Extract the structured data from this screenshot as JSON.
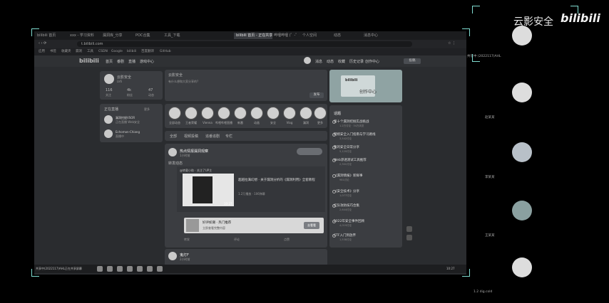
{
  "overlay": {
    "watermark": "云影安全",
    "brand": "bilibili",
    "top_right_caption": "共享中 (2022117)AHL"
  },
  "browser": {
    "tabs": [
      "bilibili 首页",
      "xxx - 学习资料",
      "漏洞库_分享",
      "POC合集",
      "工具_下载",
      "bilibili 首页 - 正在共享",
      "哔哩哔哩 (゜-゜)",
      "个人空间",
      "动态",
      "消息中心"
    ],
    "url": "t.bilibili.com",
    "bookmarks": [
      "应用",
      "书签",
      "收藏夹",
      "漏洞",
      "工具",
      "CSDN",
      "Google",
      "bilibili",
      "百度翻译",
      "GitHub"
    ]
  },
  "site": {
    "logo": "bilibili",
    "nav_left": [
      "首页",
      "番剧",
      "直播",
      "游戏中心",
      "会员购",
      "漫画",
      "赛事"
    ],
    "nav_right": [
      "消息",
      "动态",
      "收藏",
      "历史记录",
      "创作中心",
      "投稿"
    ]
  },
  "profile": {
    "name": "云影安全",
    "level": "LV6",
    "stats": [
      {
        "value": "116",
        "label": "关注"
      },
      {
        "value": "4k",
        "label": "粉丝"
      },
      {
        "value": "47",
        "label": "动态"
      }
    ]
  },
  "live": {
    "title": "正在直播",
    "more": "更多",
    "items": [
      {
        "name": "漏洞挖掘VSOR",
        "desc": "正在直播 Web安全"
      },
      {
        "name": "Echomon-Chiang",
        "desc": "直播中"
      }
    ]
  },
  "compose": {
    "title": "云影安全",
    "placeholder": "有什么想和大家分享的?",
    "publish": "发布"
  },
  "follow_circles": [
    {
      "name": "全部动态"
    },
    {
      "name": "王者荣耀"
    },
    {
      "name": "Vienna"
    },
    {
      "name": "哔哩哔哩直播"
    },
    {
      "name": "新番"
    },
    {
      "name": "动画"
    },
    {
      "name": "安全"
    },
    {
      "name": "Vlog"
    },
    {
      "name": "漏洞"
    },
    {
      "name": "更多"
    }
  ],
  "feed_tabs": [
    "全部",
    "视频投稿",
    "追番追剧",
    "专栏"
  ],
  "post1": {
    "author": "热点情报漏洞观察",
    "time": "1小时前",
    "text": "转发动态",
    "inner_author": "@转载小助 · 关注了UP主",
    "video_title": "超越拉满幻想 · 关于漏洞分析的《漏洞利用》全套教程",
    "video_meta": "1.2万播放 · 106弹幕",
    "duration": "10:27",
    "link_title": "好评如潮 · 热门推荐",
    "link_sub": "立即查看完整内容",
    "link_btn": "去看看",
    "actions": [
      "转发",
      "评论",
      "点赞"
    ]
  },
  "post2": {
    "author": "鬼灯F",
    "time": "2小时前"
  },
  "banner": {
    "text": "创作中心",
    "tag": "bilibili"
  },
  "trending": {
    "title": "话题",
    "items": [
      {
        "title": "第十个漏洞挖掘实战挑战",
        "meta": "1.2万讨论 · 34万浏览"
      },
      {
        "title": "网络安全入门指南与学习路线",
        "meta": "3,542讨论"
      },
      {
        "title": "我的安全日常分享",
        "meta": "5,120讨论"
      },
      {
        "title": "Web渗透测试工具推荐",
        "meta": "2,301讨论"
      },
      {
        "title": "《漏洞情报》新鲜事",
        "meta": "981讨论"
      },
      {
        "title": "《安全技术》分享",
        "meta": "1,077讨论"
      },
      {
        "title": "红队攻防技巧合集",
        "meta": "2,644讨论"
      },
      {
        "title": "2022年安全事件回顾",
        "meta": "4,019讨论"
      },
      {
        "title": "CTF入门到放弃",
        "meta": "1,538讨论"
      }
    ]
  },
  "taskbar": {
    "left_label": "共享中(2022117)AHL正在共享屏幕",
    "clock": "10:27"
  },
  "participants": [
    {
      "name": ""
    },
    {
      "name": "赵某某"
    },
    {
      "name": ""
    },
    {
      "name": "李某某"
    },
    {
      "name": "王某某"
    },
    {
      "name": ""
    }
  ],
  "bottom_right": "1.2 dig.cold"
}
